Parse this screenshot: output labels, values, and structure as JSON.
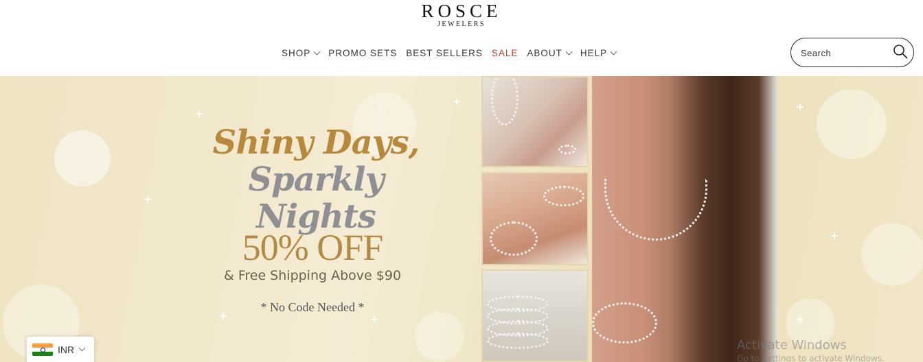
{
  "brand": {
    "name": "ROSCE",
    "tagline": "JEWELERS"
  },
  "nav": {
    "items": [
      {
        "label": "SHOP",
        "has_dropdown": true
      },
      {
        "label": "PROMO SETS",
        "has_dropdown": false
      },
      {
        "label": "BEST SELLERS",
        "has_dropdown": false
      },
      {
        "label": "SALE",
        "has_dropdown": false,
        "color": "#c0392b"
      },
      {
        "label": "ABOUT",
        "has_dropdown": true
      },
      {
        "label": "HELP",
        "has_dropdown": true
      }
    ]
  },
  "search": {
    "placeholder": "Search",
    "icon": "search-icon"
  },
  "hero": {
    "headline_line1": "Shiny Days,",
    "headline_line2": "Sparkly Nights",
    "discount": "50% OFF",
    "shipping": "& Free Shipping Above $90",
    "note": "* No Code Needed *",
    "colors": {
      "gold": "#b8893c",
      "silver": "#8e9096",
      "background": "#f1e6c6"
    }
  },
  "currency": {
    "code": "INR",
    "flag": "india-flag-icon"
  },
  "watermark": {
    "title": "Activate Windows",
    "subtitle": "Go to Settings to activate Windows."
  }
}
